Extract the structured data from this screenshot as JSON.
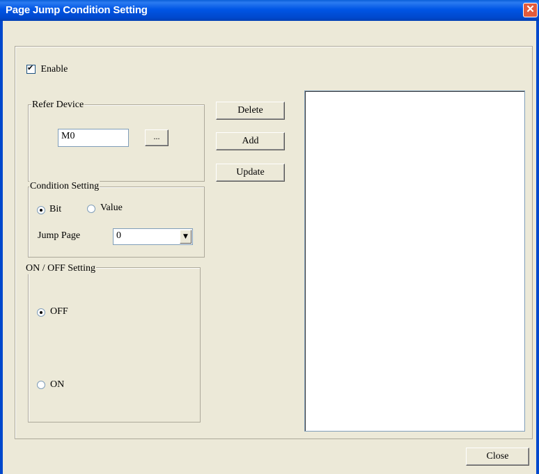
{
  "window": {
    "title": "Page Jump Condition Setting"
  },
  "enable": {
    "label": "Enable",
    "checked": true
  },
  "refer_device": {
    "legend": "Refer Device",
    "value": "M0",
    "browse_label": "..."
  },
  "buttons": {
    "delete": "Delete",
    "add": "Add",
    "update": "Update",
    "close": "Close"
  },
  "condition": {
    "legend": "Condition Setting",
    "bit_label": "Bit",
    "value_label": "Value",
    "selected": "Bit",
    "jump_page_label": "Jump Page",
    "jump_page_value": "0"
  },
  "onoff": {
    "legend": "ON / OFF Setting",
    "off_label": "OFF",
    "on_label": "ON",
    "selected": "OFF"
  },
  "icons": {
    "close": "close-icon",
    "dropdown": "chevron-down-icon"
  }
}
